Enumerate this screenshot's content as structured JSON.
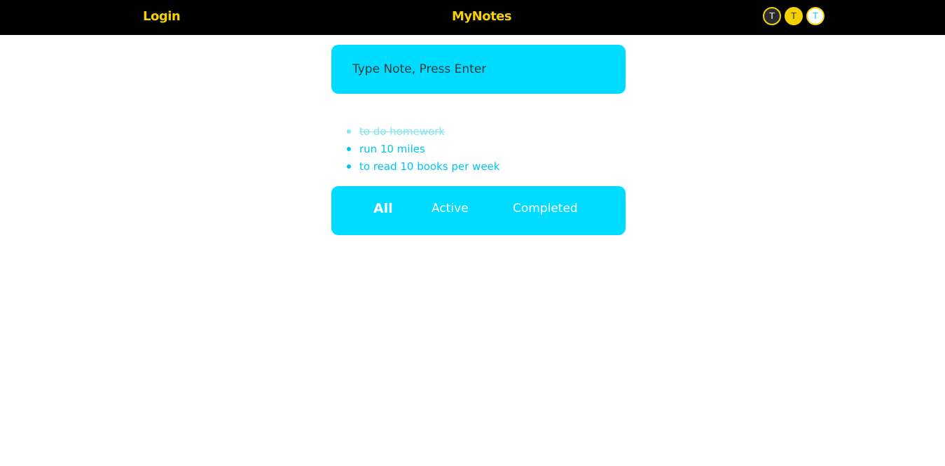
{
  "header": {
    "login_label": "Login",
    "brand": "MyNotes",
    "themes": [
      {
        "label": "T",
        "name": "dark",
        "color": "#2b2b2b"
      },
      {
        "label": "T",
        "name": "yellow",
        "color": "#f5d000"
      },
      {
        "label": "T",
        "name": "light",
        "color": "#ffffff"
      }
    ],
    "accent_color": "#f5d000"
  },
  "note_input": {
    "placeholder": "Type Note, Press Enter",
    "value": ""
  },
  "notes": [
    {
      "text": "to do homework",
      "completed": true
    },
    {
      "text": "run 10 miles",
      "completed": false
    },
    {
      "text": "to read 10 books per week",
      "completed": false
    }
  ],
  "filters": {
    "all": "All",
    "active": "Active",
    "completed": "Completed",
    "selected": "All"
  },
  "colors": {
    "primary": "#00dcff",
    "topbar": "#000000"
  }
}
